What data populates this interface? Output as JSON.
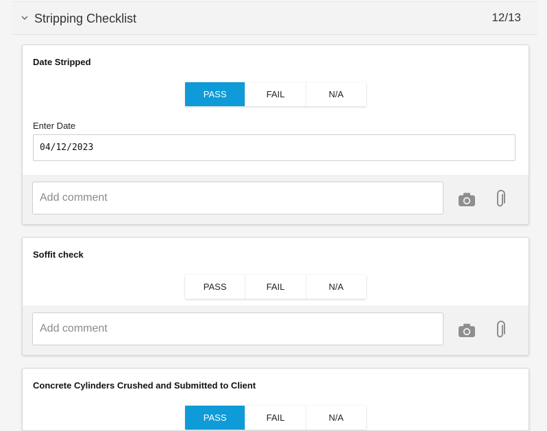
{
  "section": {
    "title": "Stripping Checklist",
    "count": "12/13"
  },
  "segment_labels": {
    "pass": "PASS",
    "fail": "FAIL",
    "na": "N/A"
  },
  "cards": [
    {
      "title": "Date Stripped",
      "selected": "PASS",
      "date_label": "Enter Date",
      "date_value": "04/12/2023",
      "comment_placeholder": "Add comment"
    },
    {
      "title": "Soffit check",
      "selected": "",
      "comment_placeholder": "Add comment"
    },
    {
      "title": "Concrete Cylinders Crushed and Submitted to Client",
      "selected": "PASS"
    }
  ],
  "colors": {
    "accent": "#0f9bd7"
  },
  "icons": {
    "collapse": "chevron-down-icon",
    "camera": "camera-icon",
    "attachment": "paperclip-icon"
  }
}
